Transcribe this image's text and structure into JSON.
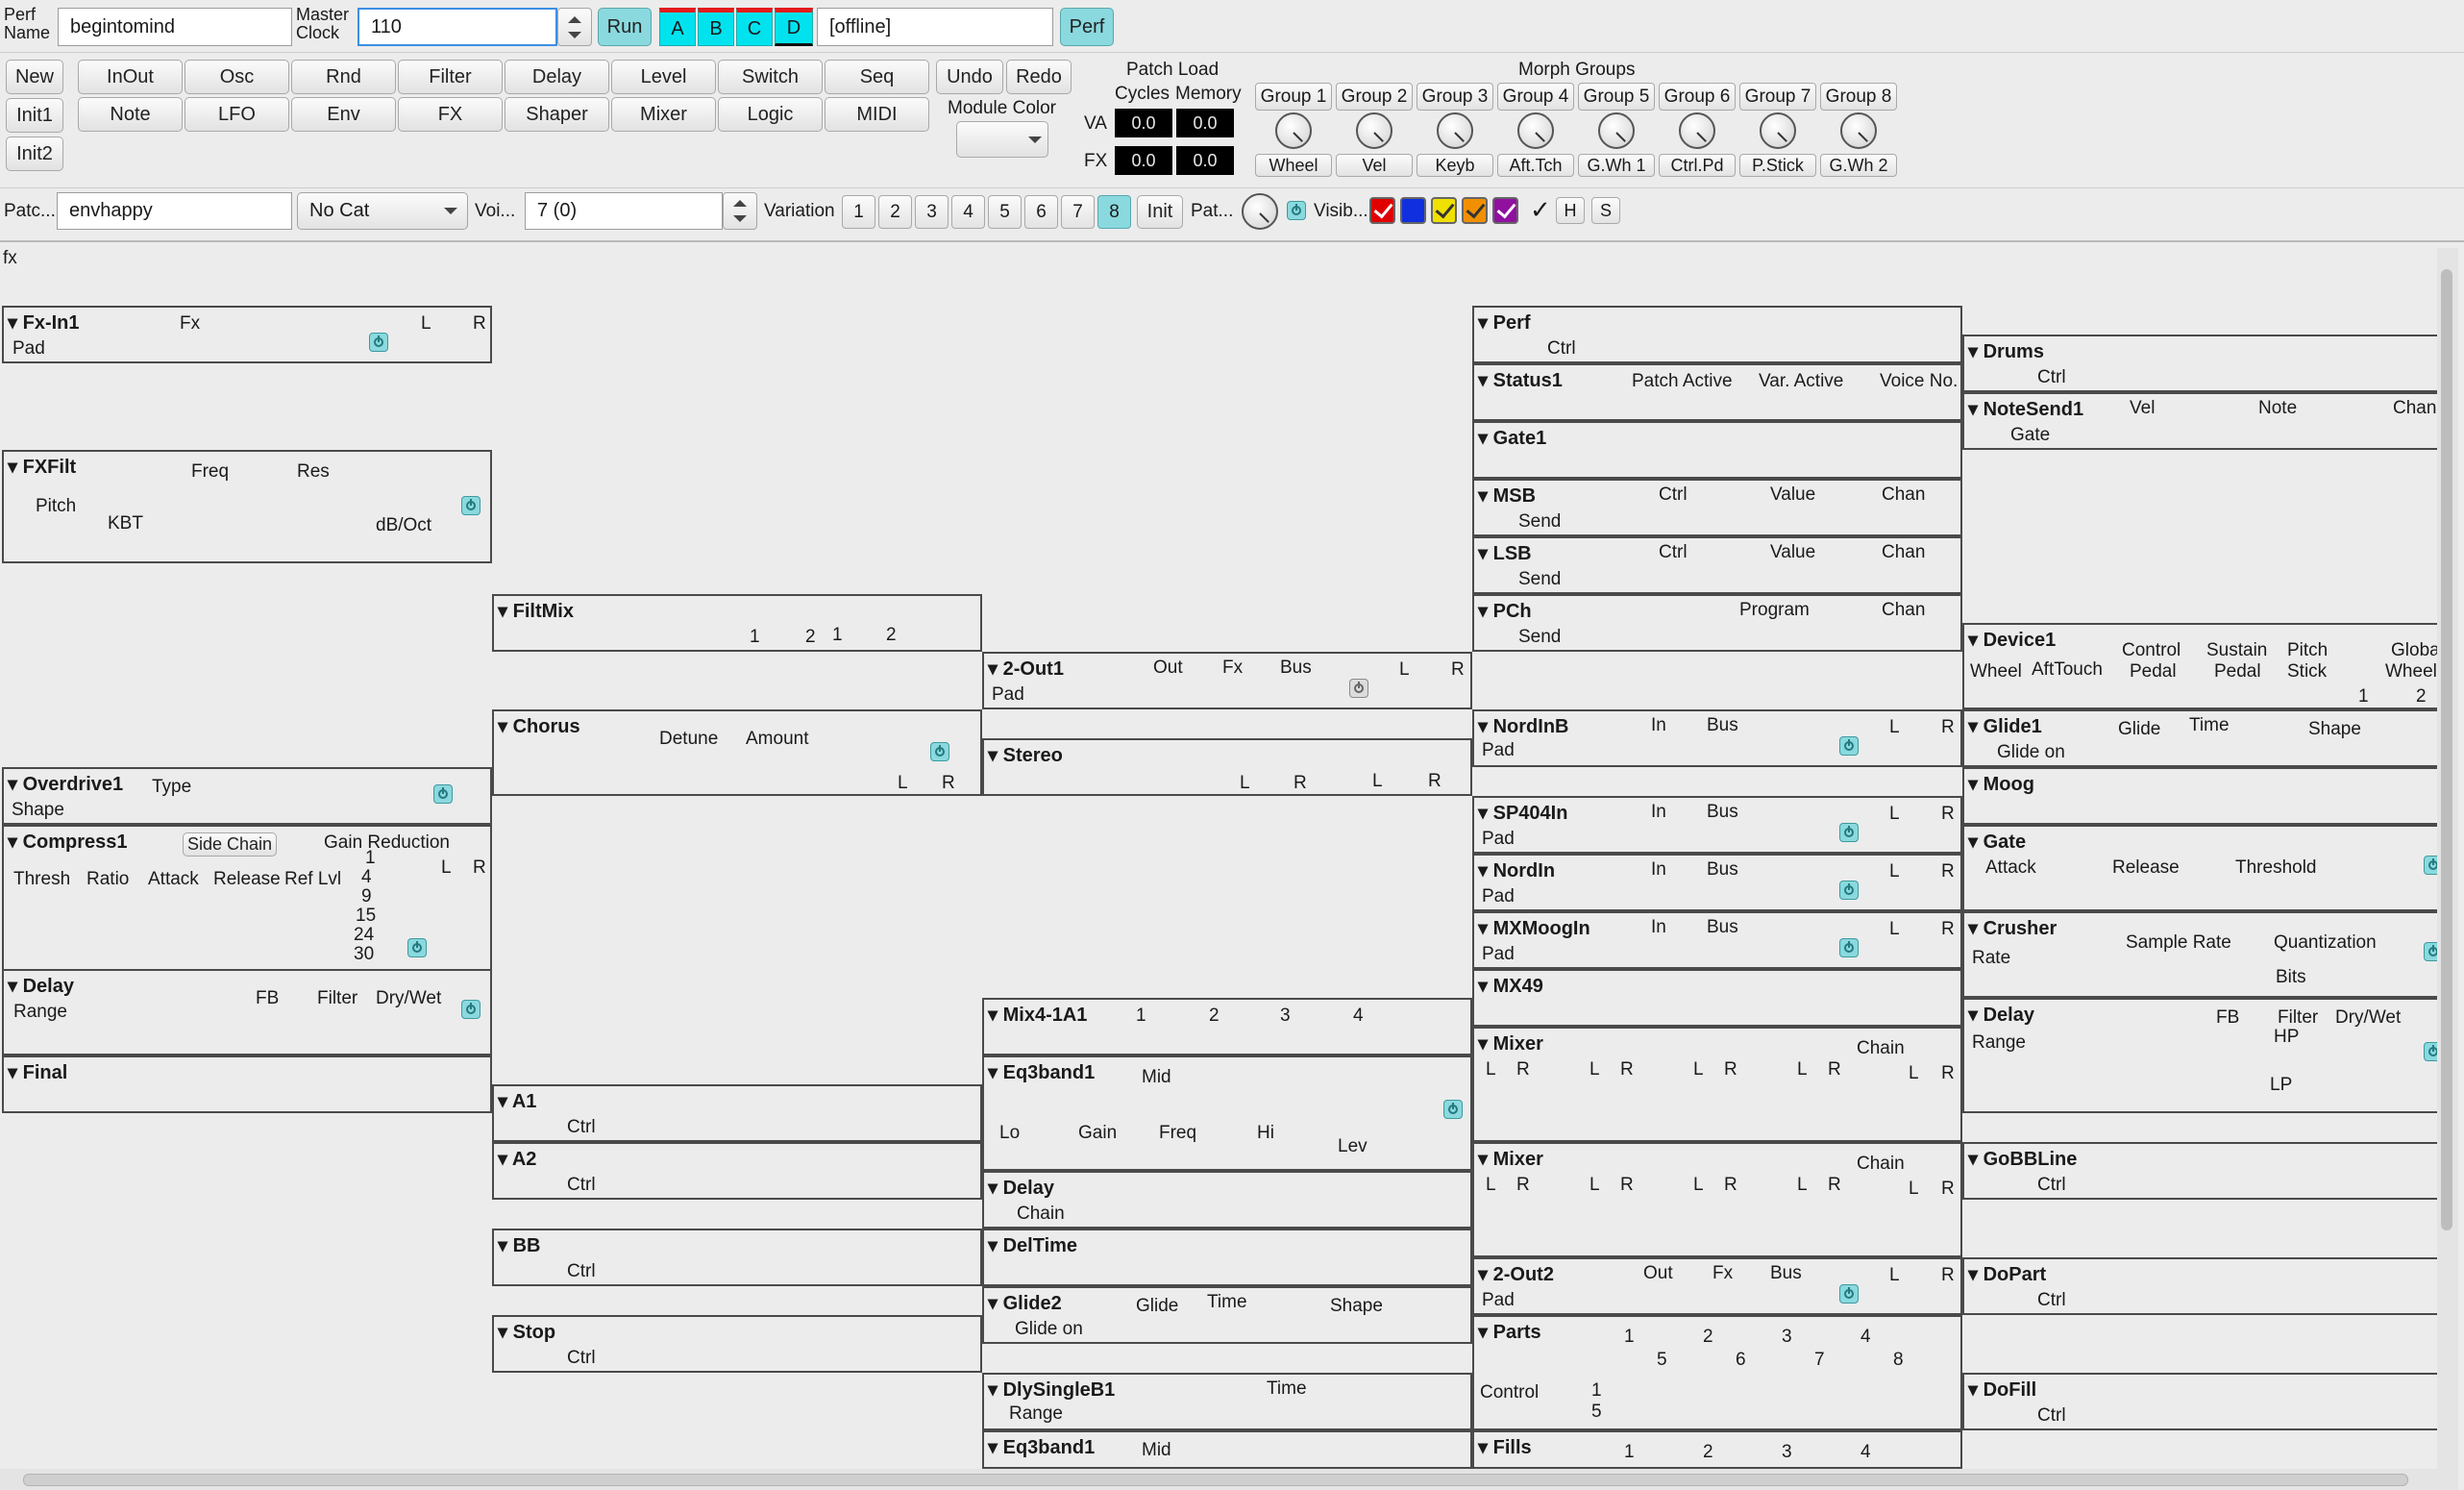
{
  "toolbar": {
    "perf_name_label": "Perf Name",
    "perf_name_value": "begintomind",
    "master_clock_label": "Master Clock",
    "master_clock_value": "110",
    "run": "Run",
    "slots": [
      "A",
      "B",
      "C",
      "D"
    ],
    "status": "[offline]",
    "perf": "Perf"
  },
  "module_buttons": {
    "new": "New",
    "init1": "Init1",
    "init2": "Init2",
    "row1": [
      "InOut",
      "Osc",
      "Rnd",
      "Filter",
      "Delay",
      "Level",
      "Switch",
      "Seq"
    ],
    "row2": [
      "Note",
      "LFO",
      "Env",
      "FX",
      "Shaper",
      "Mixer",
      "Logic",
      "MIDI"
    ],
    "undo": "Undo",
    "redo": "Redo",
    "module_color": "Module Color"
  },
  "patch_load": {
    "title": "Patch Load",
    "cycles": "Cycles",
    "memory": "Memory",
    "va": "VA",
    "fx": "FX",
    "va_cycles": "0.0",
    "va_memory": "0.0",
    "fx_cycles": "0.0",
    "fx_memory": "0.0"
  },
  "morph": {
    "title": "Morph Groups",
    "groups": [
      "Group 1",
      "Group 2",
      "Group 3",
      "Group 4",
      "Group 5",
      "Group 6",
      "Group 7",
      "Group 8"
    ],
    "labels": [
      "Wheel",
      "Vel",
      "Keyb",
      "Aft.Tch",
      "G.Wh 1",
      "Ctrl.Pd",
      "P.Stick",
      "G.Wh 2"
    ]
  },
  "patchbar": {
    "patch_label": "Patc...",
    "patch_name": "envhappy",
    "category": "No Cat",
    "voices_label": "Voi...",
    "voices_value": "7 (0)",
    "variation_label": "Variation",
    "variations": [
      "1",
      "2",
      "3",
      "4",
      "5",
      "6",
      "7",
      "8"
    ],
    "selected_variation": "8",
    "init": "Init",
    "pat_label": "Pat...",
    "visible_label": "Visib...",
    "h": "H",
    "s": "S"
  },
  "visibility_colors": [
    "#e00000",
    "#1030e0",
    "#f0e000",
    "#f09000",
    "#9010a0"
  ],
  "area_label": "fx",
  "col1": {
    "fxin1": {
      "title": "Fx-In1",
      "fx": "Fx",
      "pad": "Pad",
      "l": "L",
      "r": "R"
    },
    "fxfilt": {
      "title": "FXFilt",
      "freq": "Freq",
      "res": "Res",
      "pitch": "Pitch",
      "kbt": "KBT",
      "dboct": "dB/Oct"
    },
    "overdrive": {
      "title": "Overdrive1",
      "type": "Type",
      "shape": "Shape"
    },
    "compress": {
      "title": "Compress1",
      "side_chain": "Side Chain",
      "gain_reduction": "Gain Reduction",
      "thresh": "Thresh",
      "ratio": "Ratio",
      "attack": "Attack",
      "release": "Release",
      "ref_lvl": "Ref Lvl",
      "l": "L",
      "r": "R",
      "scale": [
        "1",
        "4",
        "9",
        "15",
        "24",
        "30"
      ]
    },
    "delay": {
      "title": "Delay",
      "fb": "FB",
      "filter": "Filter",
      "drywet": "Dry/Wet",
      "range": "Range"
    },
    "final": {
      "title": "Final"
    }
  },
  "col2": {
    "filtmix": {
      "title": "FiltMix",
      "a1": "1",
      "a2": "2",
      "b1": "1",
      "b2": "2"
    },
    "chorus": {
      "title": "Chorus",
      "detune": "Detune",
      "amount": "Amount",
      "l": "L",
      "r": "R"
    },
    "a1": {
      "title": "A1",
      "ctrl": "Ctrl"
    },
    "a2": {
      "title": "A2",
      "ctrl": "Ctrl"
    },
    "bb": {
      "title": "BB",
      "ctrl": "Ctrl"
    },
    "stop": {
      "title": "Stop",
      "ctrl": "Ctrl"
    }
  },
  "col3": {
    "out1": {
      "title": "2-Out1",
      "out": "Out",
      "fx": "Fx",
      "bus": "Bus",
      "l": "L",
      "r": "R",
      "pad": "Pad"
    },
    "stereo": {
      "title": "Stereo",
      "l1": "L",
      "r1": "R",
      "l2": "L",
      "r2": "R"
    },
    "mix41": {
      "title": "Mix4-1A1",
      "n": [
        "1",
        "2",
        "3",
        "4"
      ]
    },
    "eq3": {
      "title": "Eq3band1",
      "mid": "Mid",
      "lo": "Lo",
      "gain": "Gain",
      "freq": "Freq",
      "hi": "Hi",
      "lev": "Lev"
    },
    "delay": {
      "title": "Delay",
      "chain": "Chain"
    },
    "deltime": {
      "title": "DelTime"
    },
    "glide2": {
      "title": "Glide2",
      "glide": "Glide",
      "time": "Time",
      "shape": "Shape",
      "glide_on": "Glide on"
    },
    "dly": {
      "title": "DlySingleB1",
      "time": "Time",
      "range": "Range"
    },
    "eq3b": {
      "title": "Eq3band1",
      "mid": "Mid"
    }
  },
  "col4": {
    "perf": {
      "title": "Perf",
      "ctrl": "Ctrl"
    },
    "status": {
      "title": "Status1",
      "patch_active": "Patch Active",
      "var_active": "Var. Active",
      "voice_no": "Voice No."
    },
    "gate1": {
      "title": "Gate1"
    },
    "msb": {
      "title": "MSB",
      "ctrl": "Ctrl",
      "value": "Value",
      "chan": "Chan",
      "send": "Send"
    },
    "lsb": {
      "title": "LSB",
      "ctrl": "Ctrl",
      "value": "Value",
      "chan": "Chan",
      "send": "Send"
    },
    "pch": {
      "title": "PCh",
      "program": "Program",
      "chan": "Chan",
      "send": "Send"
    },
    "nordinb": {
      "title": "NordInB",
      "in": "In",
      "bus": "Bus",
      "l": "L",
      "r": "R",
      "pad": "Pad"
    },
    "sp404": {
      "title": "SP404In",
      "in": "In",
      "bus": "Bus",
      "l": "L",
      "r": "R",
      "pad": "Pad"
    },
    "nordin": {
      "title": "NordIn",
      "in": "In",
      "bus": "Bus",
      "l": "L",
      "r": "R",
      "pad": "Pad"
    },
    "mxmoog": {
      "title": "MXMoogIn",
      "in": "In",
      "bus": "Bus",
      "l": "L",
      "r": "R",
      "pad": "Pad"
    },
    "mx49": {
      "title": "MX49"
    },
    "mixer1": {
      "title": "Mixer",
      "chain": "Chain",
      "l": "L",
      "r": "R"
    },
    "mixer2": {
      "title": "Mixer",
      "chain": "Chain",
      "l": "L",
      "r": "R"
    },
    "out2": {
      "title": "2-Out2",
      "out": "Out",
      "fx": "Fx",
      "bus": "Bus",
      "l": "L",
      "r": "R",
      "pad": "Pad"
    },
    "parts": {
      "title": "Parts",
      "top": [
        "1",
        "2",
        "3",
        "4"
      ],
      "bottom": [
        "5",
        "6",
        "7",
        "8"
      ],
      "control": "Control",
      "c1": "1",
      "c5": "5"
    },
    "fills": {
      "title": "Fills",
      "n": [
        "1",
        "2",
        "3",
        "4"
      ]
    }
  },
  "col5": {
    "drums": {
      "title": "Drums",
      "ctrl": "Ctrl"
    },
    "notesend": {
      "title": "NoteSend1",
      "vel": "Vel",
      "note": "Note",
      "chan": "Chan",
      "gate": "Gate"
    },
    "device": {
      "title": "Device1",
      "wheel": "Wheel",
      "afttouch": "AftTouch",
      "control": "Control",
      "pedal": "Pedal",
      "sustain": "Sustain",
      "pedal2": "Pedal",
      "pitch": "Pitch",
      "stick": "Stick",
      "global": "Global",
      "wheels": "Wheels",
      "n1": "1",
      "n2": "2"
    },
    "glide1": {
      "title": "Glide1",
      "glide": "Glide",
      "time": "Time",
      "shape": "Shape",
      "glide_on": "Glide on"
    },
    "moog": {
      "title": "Moog"
    },
    "gate": {
      "title": "Gate",
      "attack": "Attack",
      "release": "Release",
      "threshold": "Threshold"
    },
    "crusher": {
      "title": "Crusher",
      "sample_rate": "Sample Rate",
      "quantization": "Quantization",
      "rate": "Rate",
      "bits": "Bits"
    },
    "delay": {
      "title": "Delay",
      "fb": "FB",
      "filter": "Filter",
      "hp": "HP",
      "lp": "LP",
      "drywet": "Dry/Wet",
      "range": "Range"
    },
    "gobbline": {
      "title": "GoBBLine",
      "ctrl": "Ctrl"
    },
    "dopart": {
      "title": "DoPart",
      "ctrl": "Ctrl"
    },
    "dofill": {
      "title": "DoFill",
      "ctrl": "Ctrl"
    }
  }
}
